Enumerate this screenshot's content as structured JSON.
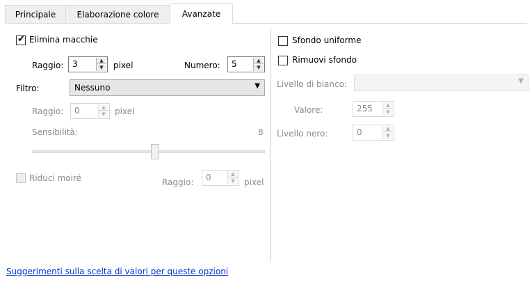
{
  "tabs": [
    {
      "label": "Principale"
    },
    {
      "label": "Elaborazione colore"
    },
    {
      "label": "Avanzate"
    }
  ],
  "left": {
    "elimina_macchie": {
      "label": "Elimina macchie",
      "checked": true
    },
    "raggio": {
      "label": "Raggio:",
      "value": "3",
      "unit": "pixel"
    },
    "numero": {
      "label": "Numero:",
      "value": "5"
    },
    "filtro": {
      "label": "Filtro:",
      "value": "Nessuno"
    },
    "filtro_raggio": {
      "label": "Raggio:",
      "value": "0",
      "unit": "pixel"
    },
    "sensibilita": {
      "label": "Sensibilità:",
      "value": "8"
    },
    "riduci_moire": {
      "label": "Riduci moiré",
      "checked": false
    },
    "moire_raggio": {
      "label": "Raggio:",
      "value": "0",
      "unit": "pixel"
    }
  },
  "right": {
    "sfondo_uniforme": {
      "label": "Sfondo uniforme",
      "checked": false
    },
    "rimuovi_sfondo": {
      "label": "Rimuovi sfondo",
      "checked": false
    },
    "livello_bianco": {
      "label": "Livello di bianco:",
      "value": ""
    },
    "valore": {
      "label": "Valore:",
      "value": "255"
    },
    "livello_nero": {
      "label": "Livello nero:",
      "value": "0"
    }
  },
  "footer": {
    "link": "Suggerimenti sulla scelta di valori per queste opzioni"
  },
  "colors": {
    "link": "#0033cc",
    "disabled_text": "#8a8a8a"
  }
}
